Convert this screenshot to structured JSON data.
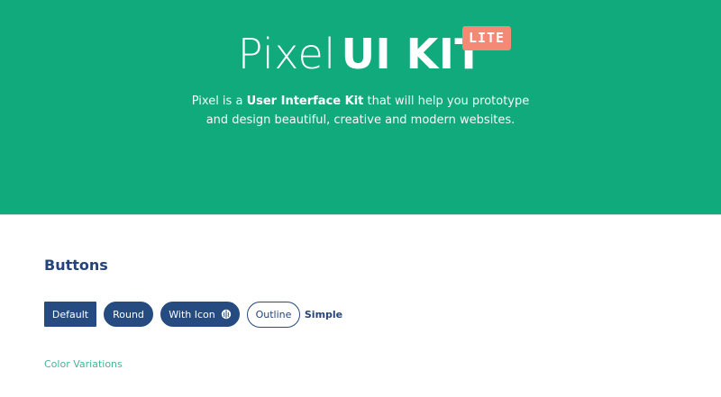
{
  "hero": {
    "title_light": "Pixel",
    "title_bold": "UI KIT",
    "badge": "LITE",
    "subtitle_line1_pre": "Pixel is a ",
    "subtitle_line1_bold": "User Interface Kit",
    "subtitle_line1_post": " that will help you prototype",
    "subtitle_line2": "and design beautiful, creative and modern websites."
  },
  "buttons_section": {
    "title": "Buttons",
    "buttons": [
      {
        "label": "Default"
      },
      {
        "label": "Round"
      },
      {
        "label": "With Icon",
        "icon": "brain-icon"
      },
      {
        "label": "Outline"
      },
      {
        "label": "Simple"
      }
    ]
  },
  "color_variations": {
    "label": "Color Variations"
  },
  "colors": {
    "hero_bg": "#10aa7d",
    "badge_bg": "#f48a75",
    "primary": "#254b80",
    "accent_text": "#4ab49a"
  }
}
